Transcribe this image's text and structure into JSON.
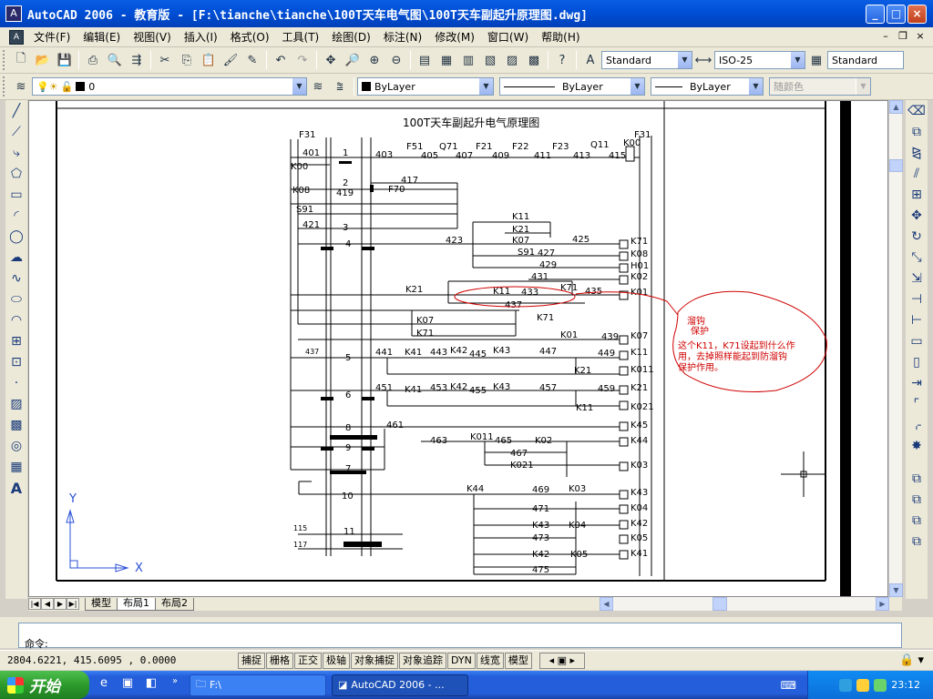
{
  "titlebar": {
    "app_icon": "autocad-icon",
    "title": "AutoCAD 2006 - 教育版 - [F:\\tianche\\tianche\\100T天车电气图\\100T天车副起升原理图.dwg]",
    "minimize": "_",
    "maximize": "□",
    "close": "×"
  },
  "menubar": {
    "items": [
      "文件(F)",
      "编辑(E)",
      "视图(V)",
      "插入(I)",
      "格式(O)",
      "工具(T)",
      "绘图(D)",
      "标注(N)",
      "修改(M)",
      "窗口(W)",
      "帮助(H)"
    ]
  },
  "toolbar_standard": {
    "text_style": "Standard",
    "dim_style": "ISO-25",
    "table_style": "Standard"
  },
  "toolbar_layers": {
    "layer": "0",
    "color": "ByLayer",
    "linetype": "ByLayer",
    "lineweight": "ByLayer",
    "plot_style": "随颜色"
  },
  "drawing": {
    "title": "100T天车副起升电气原理图",
    "annotation_line1": "溜钩",
    "annotation_line2": "保护",
    "annotation_q1": "这个K11，K71设起到什么作",
    "annotation_q2": "用，去掉照样能起到防溜钩",
    "annotation_q3": "保护作用。",
    "ucs_x": "X",
    "ucs_y": "Y",
    "rung_numbers": [
      "1",
      "2",
      "3",
      "4",
      "5",
      "6",
      "8",
      "9",
      "7",
      "10",
      "11"
    ],
    "left_labels": [
      "F31",
      "401",
      "K00",
      "K08",
      "419",
      "S91",
      "421",
      "437",
      "115",
      "117"
    ],
    "top_labels": [
      "403",
      "F51",
      "405",
      "Q71",
      "407",
      "F21",
      "409",
      "F22",
      "411",
      "F23",
      "413",
      "Q11",
      "415",
      "K00",
      "F31",
      "417",
      "F70"
    ],
    "mid_labels": [
      "K11",
      "K21",
      "K07",
      "423",
      "425",
      "S91",
      "427",
      "429",
      "431",
      "K21",
      "K11",
      "433",
      "K71",
      "435",
      "437",
      "K71",
      "K07",
      "K71",
      "K01",
      "439",
      "441",
      "K41",
      "443",
      "K42",
      "445",
      "K43",
      "447",
      "449",
      "K21",
      "451",
      "K41",
      "453",
      "K42",
      "455",
      "K43",
      "457",
      "459",
      "K11",
      "461",
      "463",
      "K011",
      "465",
      "K02",
      "467",
      "K021",
      "K44",
      "469",
      "K03",
      "471",
      "K43",
      "K04",
      "473",
      "K42",
      "K05",
      "475",
      "K41"
    ],
    "right_labels": [
      "K71",
      "K08",
      "H01",
      "K02",
      "K01",
      "K07",
      "K11",
      "K011",
      "K21",
      "K021",
      "K45",
      "K44",
      "K03",
      "K43",
      "K04",
      "K42",
      "K05",
      "K41"
    ]
  },
  "layout_tabs": [
    "模型",
    "布局1",
    "布局2"
  ],
  "command": {
    "prompt": "命令:"
  },
  "statusbar": {
    "coords": "2804.6221, 415.6095 , 0.0000",
    "toggles": [
      "捕捉",
      "栅格",
      "正交",
      "极轴",
      "对象捕捉",
      "对象追踪",
      "DYN",
      "线宽",
      "模型"
    ]
  },
  "taskbar": {
    "start": "开始",
    "items": [
      "F:\\",
      "AutoCAD 2006 - ..."
    ],
    "clock": "23:12"
  }
}
